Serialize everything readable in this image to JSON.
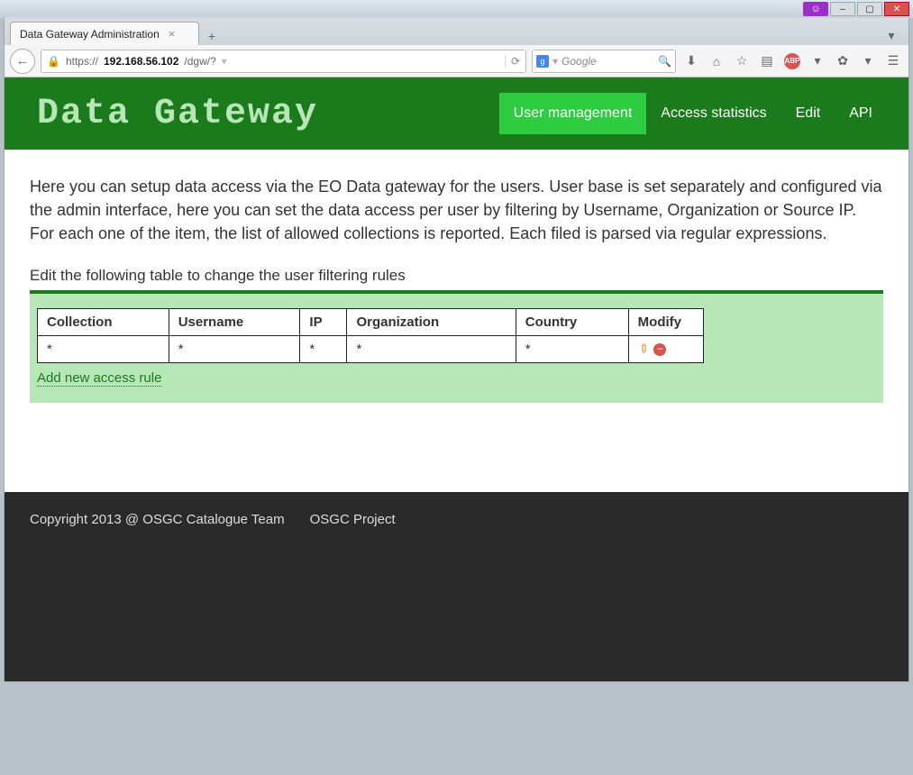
{
  "browser": {
    "tab_title": "Data Gateway Administration",
    "url_prefix": "https://",
    "url_host": "192.168.56.102",
    "url_path": "/dgw/?",
    "search_placeholder": "Google"
  },
  "header": {
    "logo": "Data Gateway",
    "nav": {
      "user_management": "User management",
      "access_statistics": "Access statistics",
      "edit": "Edit",
      "api": "API"
    }
  },
  "content": {
    "intro": "Here you can setup data access via the EO Data gateway for the users. User base is set separately and configured via the admin interface, here you can set the data access per user by filtering by Username, Organization or Source IP. For each one of the item, the list of allowed collections is reported. Each filed is parsed via regular expressions.",
    "table_label": "Edit the following table to change the user filtering rules",
    "columns": {
      "collection": "Collection",
      "username": "Username",
      "ip": "IP",
      "organization": "Organization",
      "country": "Country",
      "modify": "Modify"
    },
    "rows": [
      {
        "collection": "*",
        "username": "*",
        "ip": "*",
        "organization": "*",
        "country": "*"
      }
    ],
    "add_rule_label": "Add new access rule"
  },
  "footer": {
    "copyright": "Copyright 2013 @ OSGC Catalogue Team",
    "project_link": "OSGC Project"
  }
}
